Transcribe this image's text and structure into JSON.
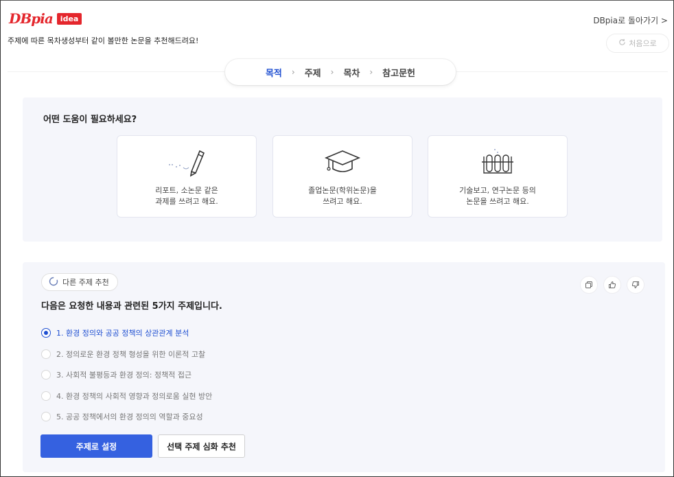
{
  "header": {
    "logo_text": "DBpia",
    "logo_badge": "idea",
    "subtitle": "주제에 따른 목차생성부터 같이 볼만한 논문을 추천해드려요!",
    "back_link": "DBpia로 돌아가기 >",
    "reset_label": "처음으로"
  },
  "stepper": {
    "steps": [
      "목적",
      "주제",
      "목차",
      "참고문헌"
    ],
    "separator": "›",
    "active_index": 0
  },
  "purpose": {
    "question": "어떤 도움이 필요하세요?",
    "cards": [
      {
        "label": "리포트, 소논문 같은\n과제를 쓰려고 해요.",
        "icon": "pen-icon"
      },
      {
        "label": "졸업논문(학위논문)을\n쓰려고 해요.",
        "icon": "graduation-cap-icon"
      },
      {
        "label": "기술보고, 연구논문 등의\n논문을 쓰려고 해요.",
        "icon": "test-tubes-icon"
      }
    ]
  },
  "topics": {
    "alt_button": "다른 주제 추천",
    "title": "다음은 요청한 내용과 관련된 5가지 주제입니다.",
    "options": [
      "1. 환경 정의와 공공 정책의 상관관계 분석",
      "2. 정의로운 환경 정책 형성을 위한 이론적 고찰",
      "3. 사회적 불평등과 환경 정의: 정책적 접근",
      "4. 환경 정책의 사회적 영향과 정의로움 실현 방안",
      "5. 공공 정책에서의 환경 정의의 역할과 중요성"
    ],
    "selected_index": 0,
    "primary_button": "주제로 설정",
    "secondary_button": "선택 주제 심화 추천",
    "action_icons": [
      "copy-icon",
      "thumbs-up-icon",
      "thumbs-down-icon"
    ]
  },
  "colors": {
    "brand_red": "#e4262c",
    "accent_blue": "#1f4fd1",
    "button_blue": "#3561e0",
    "panel_bg": "#f5f6fb"
  }
}
